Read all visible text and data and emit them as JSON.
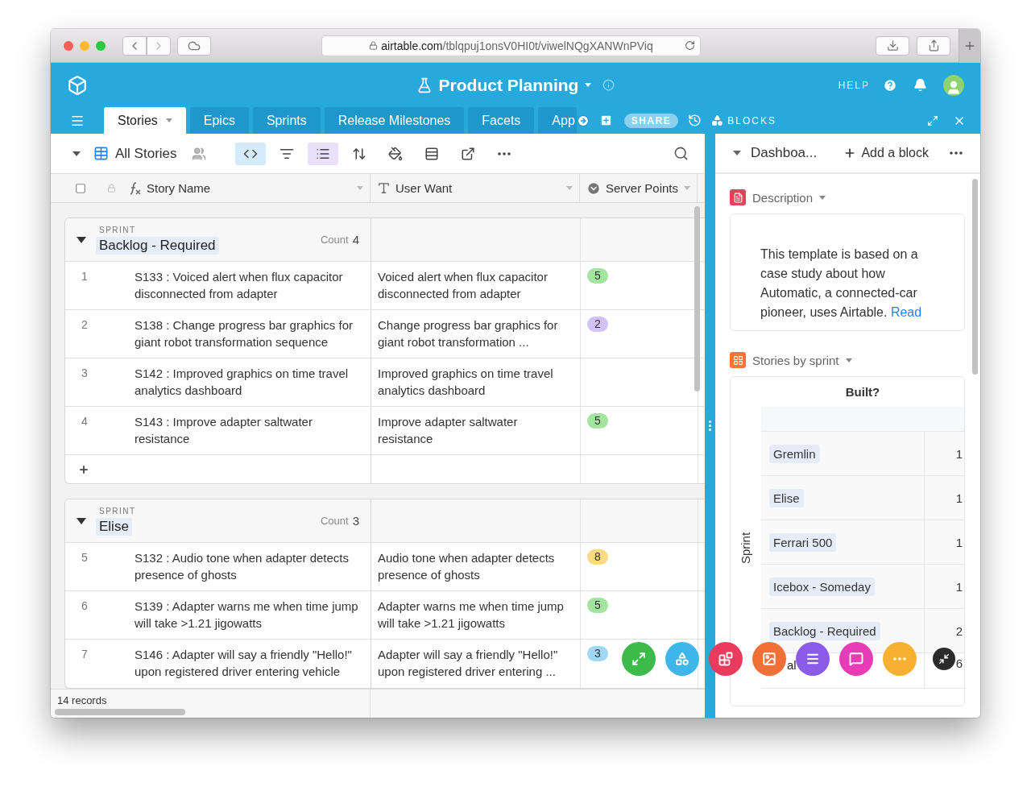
{
  "browser": {
    "url_domain": "airtable.com",
    "url_path": "/tblqpuj1onsV0HI0t/viwelNQgXANWnPViq"
  },
  "base": {
    "title": "Product Planning",
    "help": "HELP"
  },
  "tabs": [
    {
      "label": "Stories",
      "selected": true
    },
    {
      "label": "Epics",
      "selected": false
    },
    {
      "label": "Sprints",
      "selected": false
    },
    {
      "label": "Release Milestones",
      "selected": false
    },
    {
      "label": "Facets",
      "selected": false
    },
    {
      "label": "App",
      "selected": false
    }
  ],
  "share": "SHARE",
  "blocks_label": "BLOCKS",
  "view": {
    "name": "All Stories",
    "toolbar": [
      {
        "kind": "code",
        "active": true
      },
      {
        "kind": "filter",
        "active": false
      },
      {
        "kind": "group",
        "active": true
      },
      {
        "kind": "sort",
        "active": false
      },
      {
        "kind": "color",
        "active": false
      },
      {
        "kind": "height",
        "active": false
      },
      {
        "kind": "share",
        "active": false
      },
      {
        "kind": "more",
        "active": false
      }
    ]
  },
  "select_all": {
    "checked": false
  },
  "columns": [
    {
      "kind": "formula",
      "label": "Story Name"
    },
    {
      "kind": "text",
      "label": "User Want"
    },
    {
      "kind": "select",
      "label": "Server Points"
    }
  ],
  "groups": [
    {
      "field": "SPRINT",
      "name": "Backlog - Required",
      "count_label": "Count",
      "count": "4",
      "expanded": true,
      "add_row": true,
      "rows": [
        {
          "number": "1",
          "story": "S133 : Voiced alert when flux capacitor disconnected from adapter",
          "want": "Voiced alert when flux capacitor disconnected from adapter",
          "points": "5",
          "color": "#a3e49f"
        },
        {
          "number": "2",
          "story": "S138 : Change progress bar graphics for giant robot transformation sequence",
          "want": "Change progress bar graphics for giant robot transformation ...",
          "points": "2",
          "color": "#d2c2f7"
        },
        {
          "number": "3",
          "story": "S142 : Improved graphics on time travel analytics dashboard",
          "want": "Improved graphics on time travel analytics dashboard"
        },
        {
          "number": "4",
          "story": "S143 : Improve adapter saltwater resistance",
          "want": "Improve adapter saltwater resistance",
          "points": "5",
          "color": "#a3e49f"
        }
      ]
    },
    {
      "field": "SPRINT",
      "name": "Elise",
      "count_label": "Count",
      "count": "3",
      "expanded": true,
      "add_row": false,
      "rows": [
        {
          "number": "5",
          "story": "S132 : Audio tone when adapter detects presence of ghosts",
          "want": "Audio tone when adapter detects presence of ghosts",
          "points": "8",
          "color": "#fcd983"
        },
        {
          "number": "6",
          "story": "S139 : Adapter warns me when time jump will take >1.21 jigowatts",
          "want": "Adapter warns me when time jump will take >1.21 jigowatts",
          "points": "5",
          "color": "#a3e49f"
        },
        {
          "number": "7",
          "story": "S146 : Adapter will say a friendly \"Hello!\" upon registered driver entering vehicle",
          "want": "Adapter will say a friendly \"Hello!\" upon registered driver entering ...",
          "points": "3",
          "color": "#9fd8f5"
        }
      ]
    }
  ],
  "footer": "14 records",
  "dashboard": {
    "title": "Dashboa...",
    "add": "Add a block",
    "blocks": [
      {
        "kind": "description",
        "title": "Description",
        "text": "This template is based on a case study about how Automatic, a connected-car pioneer, uses Airtable.",
        "link": "Read"
      },
      {
        "kind": "pivot",
        "title": "Stories by sprint",
        "column_field": "Built?",
        "row_field": "Sprint",
        "rows": [
          {
            "label": "Gremlin",
            "value": "1"
          },
          {
            "label": "Elise",
            "value": "1"
          },
          {
            "label": "Ferrari 500",
            "value": "1"
          },
          {
            "label": "Icebox - Someday",
            "value": "1"
          },
          {
            "label": "Backlog - Required",
            "value": "2"
          }
        ],
        "total": {
          "label": "al",
          "value": "6"
        }
      }
    ]
  }
}
